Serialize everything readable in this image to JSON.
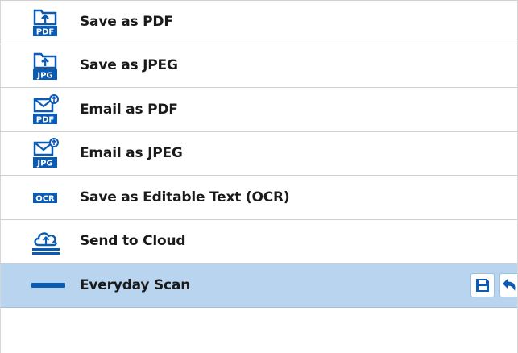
{
  "colors": {
    "icon_blue": "#0a5bb5",
    "selected_bg": "#b9d4ee",
    "divider": "#cfcfcf"
  },
  "shortcuts": [
    {
      "label": "Save as PDF",
      "icon": "save-pdf-icon",
      "badge": "PDF"
    },
    {
      "label": "Save as JPEG",
      "icon": "save-jpeg-icon",
      "badge": "JPG"
    },
    {
      "label": "Email as PDF",
      "icon": "email-pdf-icon",
      "badge": "PDF"
    },
    {
      "label": "Email as JPEG",
      "icon": "email-jpeg-icon",
      "badge": "JPG"
    },
    {
      "label": "Save as Editable Text (OCR)",
      "icon": "ocr-icon",
      "badge": "OCR"
    },
    {
      "label": "Send to Cloud",
      "icon": "cloud-upload-icon"
    },
    {
      "label": "Everyday Scan",
      "icon": "everyday-scan-icon",
      "selected": true
    }
  ],
  "row_actions": [
    {
      "icon": "save-icon"
    },
    {
      "icon": "undo-icon"
    }
  ]
}
